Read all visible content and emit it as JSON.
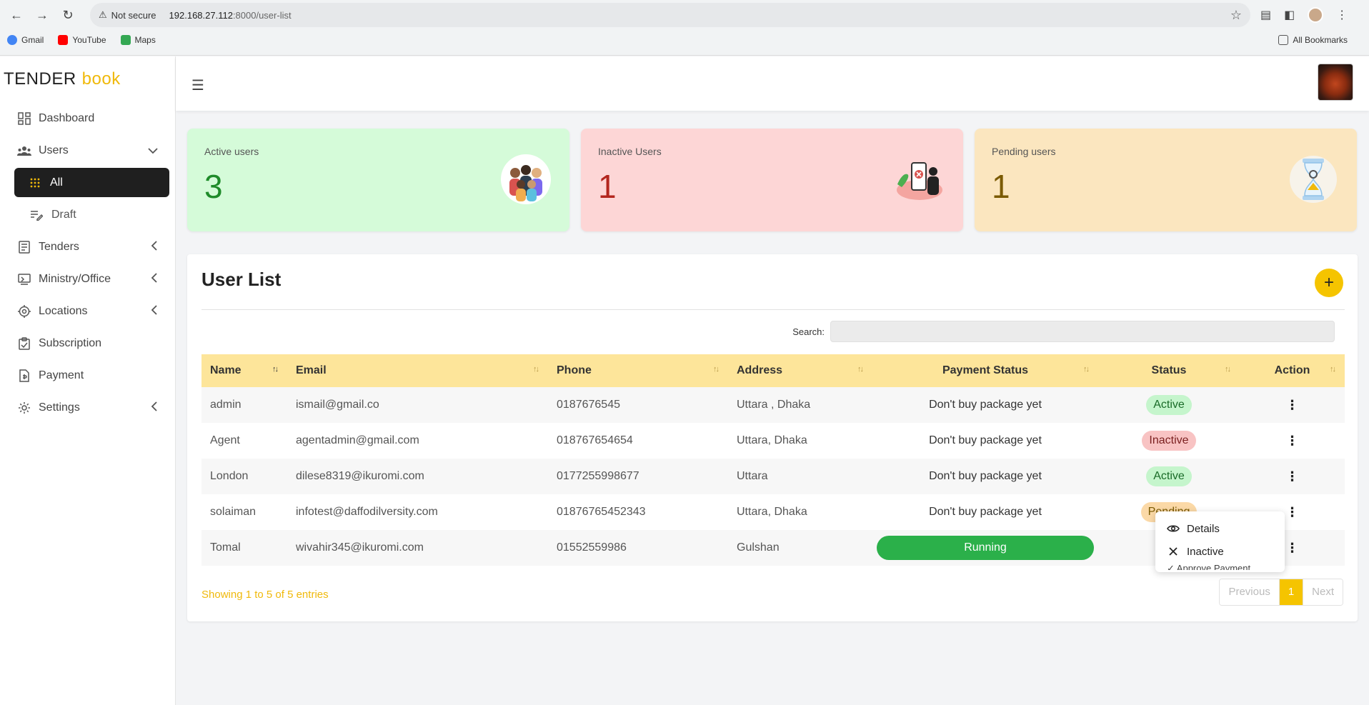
{
  "browser": {
    "security_label": "Not secure",
    "url_host": "192.168.27.112",
    "url_path": ":8000/user-list",
    "bookmarks": [
      "Gmail",
      "YouTube",
      "Maps"
    ],
    "all_bookmarks": "All Bookmarks"
  },
  "brand": {
    "part1": "TENDER",
    "part2": "book"
  },
  "sidebar": {
    "items": [
      {
        "label": "Dashboard",
        "icon": "dashboard-icon"
      },
      {
        "label": "Users",
        "icon": "users-icon",
        "caret": "chevron-down-icon"
      },
      {
        "label": "Tenders",
        "icon": "document-icon",
        "caret": "chevron-left-icon"
      },
      {
        "label": "Ministry/Office",
        "icon": "office-icon",
        "caret": "chevron-left-icon"
      },
      {
        "label": "Locations",
        "icon": "location-icon",
        "caret": "chevron-left-icon"
      },
      {
        "label": "Subscription",
        "icon": "clipboard-icon"
      },
      {
        "label": "Payment",
        "icon": "payment-icon"
      },
      {
        "label": "Settings",
        "icon": "gear-icon",
        "caret": "chevron-left-icon"
      }
    ],
    "sub_items": [
      {
        "label": "All",
        "icon": "grid-icon",
        "active": true
      },
      {
        "label": "Draft",
        "icon": "edit-list-icon"
      }
    ]
  },
  "stats": {
    "active": {
      "label": "Active users",
      "value": "3"
    },
    "inactive": {
      "label": "Inactive Users",
      "value": "1"
    },
    "pending": {
      "label": "Pending users",
      "value": "1"
    }
  },
  "panel": {
    "title": "User List",
    "search_label": "Search:",
    "columns": [
      "Name",
      "Email",
      "Phone",
      "Address",
      "Payment Status",
      "Status",
      "Action"
    ],
    "rows": [
      {
        "name": "admin",
        "email": "ismail@gmail.co",
        "phone": "0187676545",
        "address": "Uttara , Dhaka",
        "payment": "Don't buy package yet",
        "status": "Active"
      },
      {
        "name": "Agent",
        "email": "agentadmin@gmail.com",
        "phone": "018767654654",
        "address": "Uttara, Dhaka",
        "payment": "Don't buy package yet",
        "status": "Inactive"
      },
      {
        "name": "London",
        "email": "dilese8319@ikuromi.com",
        "phone": "0177255998677",
        "address": "Uttara",
        "payment": "Don't buy package yet",
        "status": "Active"
      },
      {
        "name": "solaiman",
        "email": "infotest@daffodilversity.com",
        "phone": "01876765452343",
        "address": "Uttara, Dhaka",
        "payment": "Don't buy package yet",
        "status": "Pending"
      },
      {
        "name": "Tomal",
        "email": "wivahir345@ikuromi.com",
        "phone": "01552559986",
        "address": "Gulshan",
        "payment": "Running",
        "status": ""
      }
    ],
    "showing": "Showing 1 to 5 of 5 entries",
    "pagination": {
      "previous": "Previous",
      "current": "1",
      "next": "Next"
    }
  },
  "action_menu": {
    "items": [
      {
        "label": "Details",
        "icon": "eye-icon"
      },
      {
        "label": "Inactive",
        "icon": "close-icon"
      },
      {
        "label": "Approve Payment",
        "icon": "check-icon"
      }
    ]
  },
  "colors": {
    "accent": "#f5c400",
    "active_card": "#d5fbd9",
    "inactive_card": "#fdd6d6",
    "pending_card": "#fbe6bf",
    "running": "#2bb04a"
  }
}
